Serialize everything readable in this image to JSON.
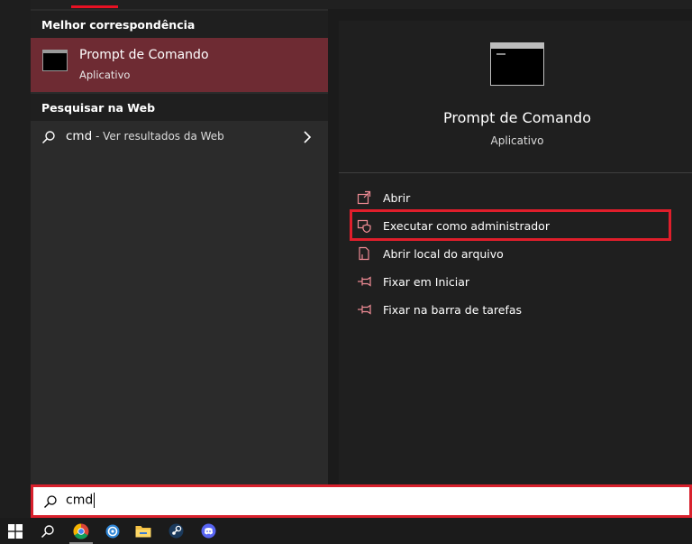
{
  "search_panel": {
    "best_match_header": "Melhor correspondência",
    "best_match": {
      "title": "Prompt de Comando",
      "subtitle": "Aplicativo",
      "icon": "cmd-app-icon"
    },
    "web_header": "Pesquisar na Web",
    "web_result": {
      "query": "cmd",
      "suffix": " - Ver resultados da Web"
    }
  },
  "detail_panel": {
    "title": "Prompt de Comando",
    "subtitle": "Aplicativo",
    "actions": [
      {
        "label": "Abrir",
        "icon": "open-icon"
      },
      {
        "label": "Executar como administrador",
        "icon": "admin-shield-icon"
      },
      {
        "label": "Abrir local do arquivo",
        "icon": "file-location-icon"
      },
      {
        "label": "Fixar em Iniciar",
        "icon": "pin-icon"
      },
      {
        "label": "Fixar na barra de tarefas",
        "icon": "pin-icon"
      }
    ]
  },
  "search_bar": {
    "value": "cmd"
  },
  "taskbar": {
    "items": [
      "start-windows-icon",
      "search-icon",
      "chrome-icon",
      "app-circle-icon",
      "file-explorer-icon",
      "steam-icon",
      "discord-icon"
    ]
  },
  "colors": {
    "accent": "#e81123",
    "highlight": "#e01e2b",
    "selected_row": "#6e2b33",
    "icon_pink": "#f08c95"
  }
}
